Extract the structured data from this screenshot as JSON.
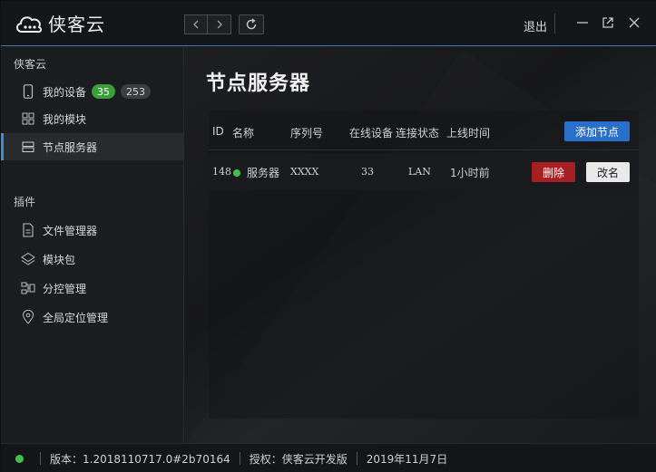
{
  "app": {
    "name": "侠客云",
    "logout_label": "退出"
  },
  "sidebar": {
    "section1_title": "侠客云",
    "items": [
      {
        "label": "我的设备",
        "icon": "phone-icon",
        "badges": [
          "35",
          "253"
        ]
      },
      {
        "label": "我的模块",
        "icon": "grid-icon"
      },
      {
        "label": "节点服务器",
        "icon": "server-icon",
        "active": true
      }
    ],
    "section2_title": "插件",
    "plugins": [
      {
        "label": "文件管理器",
        "icon": "file-icon"
      },
      {
        "label": "模块包",
        "icon": "layers-icon"
      },
      {
        "label": "分控管理",
        "icon": "network-icon"
      },
      {
        "label": "全局定位管理",
        "icon": "location-pin-icon"
      }
    ]
  },
  "main": {
    "title": "节点服务器",
    "add_button": "添加节点",
    "columns": [
      "ID",
      "名称",
      "序列号",
      "在线设备",
      "连接状态",
      "上线时间"
    ],
    "rows": [
      {
        "id": "148",
        "name": "服务器",
        "serial": "XXXX",
        "online": "33",
        "status": "LAN",
        "uptime": "1小时前",
        "delete_label": "删除",
        "rename_label": "改名"
      }
    ]
  },
  "statusbar": {
    "version": "版本：1.2018110717.0#2b70164",
    "license": "授权：侠客云开发版",
    "date": "2019年11月7日"
  },
  "colors": {
    "accent": "#2a6fc9",
    "online": "#3fc24b",
    "danger": "#a81f23"
  }
}
